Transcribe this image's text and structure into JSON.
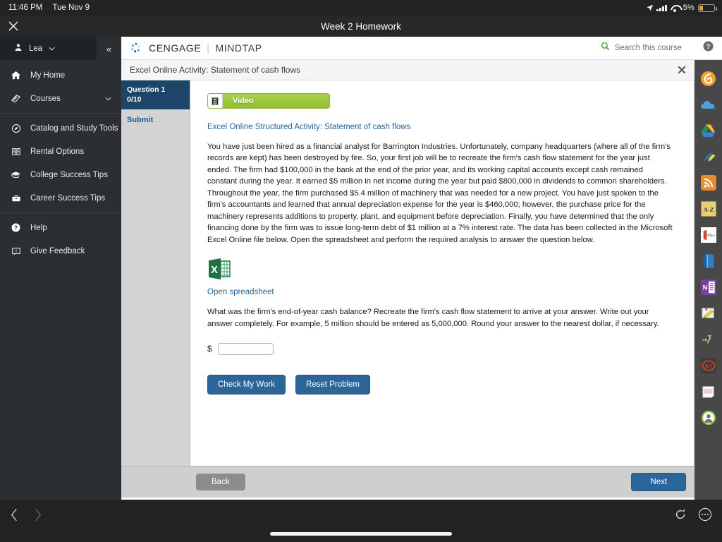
{
  "statusbar": {
    "time": "11:46 PM",
    "date": "Tue Nov 9",
    "battery_pct": "5%",
    "icons": [
      "location-arrow-icon",
      "cellular-signal-icon",
      "wifi-icon",
      "battery-icon"
    ]
  },
  "titlebar": {
    "title": "Week 2 Homework",
    "close_icon": "close-icon"
  },
  "sidebar": {
    "user": {
      "name": "Lea",
      "icon": "person-icon",
      "caret": "⌄"
    },
    "collapse_label": "«",
    "items": [
      {
        "label": "My Home",
        "icon": "home-icon"
      },
      {
        "label": "Courses",
        "icon": "book-icon",
        "chevron": "⌄"
      },
      {
        "label": "Catalog and Study Tools",
        "icon": "compass-icon"
      },
      {
        "label": "Rental Options",
        "icon": "open-book-icon"
      },
      {
        "label": "College Success Tips",
        "icon": "graduation-cap-icon"
      },
      {
        "label": "Career Success Tips",
        "icon": "briefcase-icon"
      },
      {
        "label": "Help",
        "icon": "question-circle-icon"
      },
      {
        "label": "Give Feedback",
        "icon": "feedback-icon"
      }
    ]
  },
  "mindtap": {
    "brand_cengage": "CENGAGE",
    "brand_divider": "|",
    "brand_mindtap": "MINDTAP",
    "search_placeholder": "Search this course",
    "search_icon": "search-icon",
    "activity_title": "Excel Online Activity: Statement of cash flows",
    "activity_close_icon": "close-icon"
  },
  "question_panel": {
    "question_label": "Question 1",
    "score": "0/10",
    "submit_label": "Submit"
  },
  "content": {
    "video_button_label": "Video",
    "video_icon": "film-strip-icon",
    "activity_heading": "Excel Online Structured Activity: Statement of cash flows",
    "paragraph": "You have just been hired as a financial analyst for Barrington Industries. Unfortunately, company headquarters (where all of the firm's records are kept) has been destroyed by fire. So, your first job will be to recreate the firm's cash flow statement for the year just ended. The firm had $100,000 in the bank at the end of the prior year, and its working capital accounts except cash remained constant during the year. It earned $5 million in net income during the year but paid $800,000 in dividends to common shareholders. Throughout the year, the firm purchased $5.4 million of machinery that was needed for a new project. You have just spoken to the firm's accountants and learned that annual depreciation expense for the year is $460,000; however, the purchase price for the machinery represents additions to property, plant, and equipment before depreciation. Finally, you have determined that the only financing done by the firm was to issue long-term debt of $1 million at a 7% interest rate. The data has been collected in the Microsoft Excel Online file below. Open the spreadsheet and perform the required analysis to answer the question below.",
    "spreadsheet_icon": "excel-file-icon",
    "open_spreadsheet_label": "Open spreadsheet",
    "question_text": "What was the firm's end-of-year cash balance? Recreate the firm's cash flow statement to arrive at your answer. Write out your answer completely. For example, 5 million should be entered as 5,000,000. Round your answer to the nearest dollar, if necessary.",
    "currency_symbol": "$",
    "answer_value": "",
    "answer_placeholder": "",
    "check_work_label": "Check My Work",
    "reset_problem_label": "Reset Problem"
  },
  "footer": {
    "back_label": "Back",
    "next_label": "Next"
  },
  "rail": {
    "help_icon": "question-circle-icon",
    "items": [
      {
        "icon": "orange-swirl-icon"
      },
      {
        "icon": "cloud-icon"
      },
      {
        "icon": "google-drive-icon"
      },
      {
        "icon": "pen-highlighter-icon"
      },
      {
        "icon": "rss-icon"
      },
      {
        "icon": "dictionary-a-z-icon",
        "label": "A-Z"
      },
      {
        "icon": "ms-office-icon",
        "label": "Office"
      },
      {
        "icon": "blue-book-icon"
      },
      {
        "icon": "onenote-icon",
        "label": "N"
      },
      {
        "icon": "notebook-pencil-icon"
      },
      {
        "icon": "read-aloud-icon"
      },
      {
        "icon": "a-plus-grade-icon",
        "label": "A+"
      },
      {
        "icon": "notepad-icon"
      },
      {
        "icon": "user-avatar-icon"
      }
    ]
  },
  "browserbar": {
    "back_icon": "chevron-left-icon",
    "forward_icon": "chevron-right-icon",
    "reload_icon": "reload-icon",
    "more_icon": "more-options-icon"
  },
  "colors": {
    "accent_blue": "#2a6699",
    "question_active": "#1d4469",
    "video_green": "#93c030",
    "link_blue": "#2a6496",
    "sidebar_bg": "#2b2f33"
  }
}
